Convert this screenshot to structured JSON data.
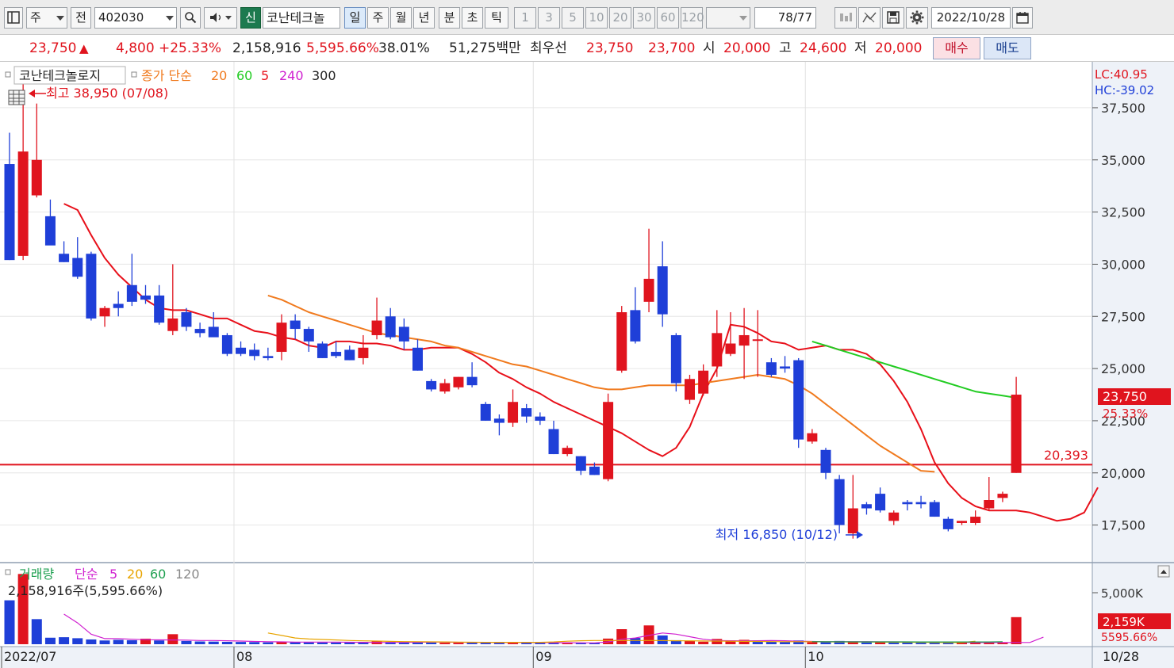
{
  "toolbar": {
    "type_select": "주",
    "prev_label": "전",
    "code_value": "402030",
    "new_badge": "신",
    "stock_name": "코난테크놀",
    "periods": [
      "일",
      "주",
      "월",
      "년",
      "분",
      "초",
      "틱"
    ],
    "selected_period": "일",
    "intervals": [
      "1",
      "3",
      "5",
      "10",
      "20",
      "30",
      "60",
      "120"
    ],
    "count": "78/77",
    "date": "2022/10/28"
  },
  "quote": {
    "price": "23,750",
    "change": "4,800",
    "change_pct": "+25.33%",
    "volume": "2,158,916",
    "volume_ratio": "5,595.66%",
    "turnover": "38.01%",
    "amount": "51,275백만",
    "best_bid_label": "최우선",
    "ask": "23,750",
    "bid": "23,700",
    "open_label": "시",
    "open": "20,000",
    "high_label": "고",
    "high": "24,600",
    "low_label": "저",
    "low": "20,000",
    "buy_label": "매수",
    "sell_label": "매도",
    "colors": {
      "up": "#e0141e",
      "down": "#1f3fd8"
    }
  },
  "price_panel": {
    "name_label": "코난테크놀로지",
    "ma_title": "종가 단순",
    "ma_periods": [
      {
        "label": "20",
        "color": "#f07a1e"
      },
      {
        "label": "60",
        "color": "#22cc22"
      },
      {
        "label": "5",
        "color": "#e8101a"
      },
      {
        "label": "240",
        "color": "#d020d0"
      },
      {
        "label": "300",
        "color": "#222222"
      }
    ],
    "high_annotation": "최고 38,950 (07/08)",
    "low_annotation": "최저 16,850 (10/12)",
    "lc_text": "LC:40.95",
    "hc_text": "HC:-39.02",
    "current_price_label": "23,750",
    "current_pct_label": "25.33%",
    "horizontal_line_label": "20,393"
  },
  "volume_panel": {
    "title": "거래량",
    "ma_title": "단순",
    "ma_periods": [
      {
        "label": "5",
        "color": "#d020d0"
      },
      {
        "label": "20",
        "color": "#e8a400"
      },
      {
        "label": "60",
        "color": "#1ea050"
      },
      {
        "label": "120",
        "color": "#888888"
      }
    ],
    "info": "2,158,916주(5,595.66%)",
    "axis_label": "5,000K",
    "current_label": "2,159K",
    "current_pct": "5595.66%"
  },
  "x_axis": {
    "labels": [
      "2022/07",
      "08",
      "09",
      "10"
    ],
    "right_label": "10/28"
  },
  "chart_data": {
    "type": "candlestick",
    "title": "코난테크놀로지",
    "y_ticks": [
      17500,
      20000,
      22500,
      25000,
      27500,
      30000,
      32500,
      35000,
      37500
    ],
    "ylim": [
      15700,
      39700
    ],
    "horizontal_line": 20393,
    "candles": [
      {
        "o": 34800,
        "h": 36300,
        "l": 30200,
        "c": 30200
      },
      {
        "o": 30400,
        "h": 38950,
        "l": 30200,
        "c": 35400
      },
      {
        "o": 33300,
        "h": 37700,
        "l": 33200,
        "c": 35000
      },
      {
        "o": 32300,
        "h": 33100,
        "l": 31000,
        "c": 30900
      },
      {
        "o": 30500,
        "h": 31100,
        "l": 30100,
        "c": 30100
      },
      {
        "o": 30300,
        "h": 31300,
        "l": 29300,
        "c": 29400
      },
      {
        "o": 30500,
        "h": 30600,
        "l": 27300,
        "c": 27400
      },
      {
        "o": 27500,
        "h": 28000,
        "l": 27000,
        "c": 27900
      },
      {
        "o": 28100,
        "h": 28700,
        "l": 27500,
        "c": 27900
      },
      {
        "o": 29000,
        "h": 30500,
        "l": 28000,
        "c": 28200
      },
      {
        "o": 28500,
        "h": 29000,
        "l": 28100,
        "c": 28300
      },
      {
        "o": 28500,
        "h": 29000,
        "l": 27100,
        "c": 27200
      },
      {
        "o": 26800,
        "h": 30000,
        "l": 26600,
        "c": 27400
      },
      {
        "o": 27700,
        "h": 27900,
        "l": 26800,
        "c": 27000
      },
      {
        "o": 26900,
        "h": 27200,
        "l": 26500,
        "c": 26700
      },
      {
        "o": 27000,
        "h": 27700,
        "l": 26600,
        "c": 26500
      },
      {
        "o": 26600,
        "h": 26700,
        "l": 25600,
        "c": 25700
      },
      {
        "o": 26000,
        "h": 26300,
        "l": 25600,
        "c": 25700
      },
      {
        "o": 25900,
        "h": 26200,
        "l": 25400,
        "c": 25600
      },
      {
        "o": 25600,
        "h": 26000,
        "l": 25400,
        "c": 25500
      },
      {
        "o": 25800,
        "h": 27600,
        "l": 25400,
        "c": 27200
      },
      {
        "o": 27300,
        "h": 27600,
        "l": 26400,
        "c": 26900
      },
      {
        "o": 26900,
        "h": 27000,
        "l": 25800,
        "c": 26300
      },
      {
        "o": 26200,
        "h": 26300,
        "l": 25500,
        "c": 25500
      },
      {
        "o": 25800,
        "h": 26300,
        "l": 25500,
        "c": 25600
      },
      {
        "o": 25900,
        "h": 26100,
        "l": 25400,
        "c": 25400
      },
      {
        "o": 25500,
        "h": 26600,
        "l": 25200,
        "c": 26000
      },
      {
        "o": 26600,
        "h": 28400,
        "l": 26400,
        "c": 27300
      },
      {
        "o": 27500,
        "h": 27900,
        "l": 26400,
        "c": 26500
      },
      {
        "o": 27000,
        "h": 27400,
        "l": 25900,
        "c": 26300
      },
      {
        "o": 26000,
        "h": 26400,
        "l": 24900,
        "c": 24900
      },
      {
        "o": 24400,
        "h": 24500,
        "l": 23900,
        "c": 24000
      },
      {
        "o": 23900,
        "h": 24500,
        "l": 23800,
        "c": 24300
      },
      {
        "o": 24100,
        "h": 24600,
        "l": 24000,
        "c": 24600
      },
      {
        "o": 24600,
        "h": 25300,
        "l": 24100,
        "c": 24200
      },
      {
        "o": 23300,
        "h": 23400,
        "l": 22500,
        "c": 22500
      },
      {
        "o": 22600,
        "h": 22800,
        "l": 21800,
        "c": 22400
      },
      {
        "o": 22400,
        "h": 24000,
        "l": 22200,
        "c": 23400
      },
      {
        "o": 23100,
        "h": 23300,
        "l": 22400,
        "c": 22700
      },
      {
        "o": 22700,
        "h": 22900,
        "l": 22300,
        "c": 22500
      },
      {
        "o": 22100,
        "h": 22500,
        "l": 20900,
        "c": 20900
      },
      {
        "o": 20900,
        "h": 21300,
        "l": 20800,
        "c": 21200
      },
      {
        "o": 20800,
        "h": 20800,
        "l": 19900,
        "c": 20100
      },
      {
        "o": 20300,
        "h": 20500,
        "l": 19900,
        "c": 19900
      },
      {
        "o": 19700,
        "h": 23800,
        "l": 19600,
        "c": 23400
      },
      {
        "o": 24900,
        "h": 28000,
        "l": 24800,
        "c": 27700
      },
      {
        "o": 27800,
        "h": 28900,
        "l": 26200,
        "c": 26300
      },
      {
        "o": 28200,
        "h": 31700,
        "l": 27700,
        "c": 29300
      },
      {
        "o": 29900,
        "h": 31100,
        "l": 27000,
        "c": 27600
      },
      {
        "o": 26600,
        "h": 26700,
        "l": 23900,
        "c": 24300
      },
      {
        "o": 23500,
        "h": 24700,
        "l": 23300,
        "c": 24500
      },
      {
        "o": 23800,
        "h": 25200,
        "l": 23700,
        "c": 24900
      },
      {
        "o": 25100,
        "h": 27800,
        "l": 24600,
        "c": 26700
      },
      {
        "o": 25700,
        "h": 27700,
        "l": 25600,
        "c": 26200
      },
      {
        "o": 26100,
        "h": 27900,
        "l": 24500,
        "c": 26600
      },
      {
        "o": 26400,
        "h": 27800,
        "l": 24600,
        "c": 26400
      },
      {
        "o": 25300,
        "h": 25500,
        "l": 24600,
        "c": 24700
      },
      {
        "o": 25100,
        "h": 25600,
        "l": 24800,
        "c": 25000
      },
      {
        "o": 25400,
        "h": 25500,
        "l": 21200,
        "c": 21600
      },
      {
        "o": 21500,
        "h": 22100,
        "l": 21400,
        "c": 21900
      },
      {
        "o": 21100,
        "h": 21200,
        "l": 19700,
        "c": 20000
      },
      {
        "o": 19700,
        "h": 19900,
        "l": 17100,
        "c": 17500
      },
      {
        "o": 17100,
        "h": 19900,
        "l": 16850,
        "c": 18300
      },
      {
        "o": 18500,
        "h": 18600,
        "l": 18000,
        "c": 18300
      },
      {
        "o": 19000,
        "h": 19300,
        "l": 18100,
        "c": 18200
      },
      {
        "o": 17700,
        "h": 18200,
        "l": 17500,
        "c": 18100
      },
      {
        "o": 18600,
        "h": 18700,
        "l": 18200,
        "c": 18500
      },
      {
        "o": 18600,
        "h": 18900,
        "l": 18300,
        "c": 18500
      },
      {
        "o": 18600,
        "h": 18700,
        "l": 17900,
        "c": 17900
      },
      {
        "o": 17800,
        "h": 17900,
        "l": 17200,
        "c": 17300
      },
      {
        "o": 17600,
        "h": 17700,
        "l": 17500,
        "c": 17700
      },
      {
        "o": 17600,
        "h": 18200,
        "l": 17500,
        "c": 17900
      },
      {
        "o": 18300,
        "h": 19800,
        "l": 18200,
        "c": 18700
      },
      {
        "o": 18800,
        "h": 19100,
        "l": 18600,
        "c": 19000
      },
      {
        "o": 20000,
        "h": 24600,
        "l": 20000,
        "c": 23750
      }
    ],
    "series": [
      {
        "name": "5",
        "start_index": 4,
        "values": [
          32900,
          32600,
          31400,
          30300,
          29500,
          28900,
          28300,
          27900,
          27800,
          27800,
          27600,
          27400,
          27400,
          27100,
          26800,
          26700,
          26500,
          26400,
          26100,
          26000,
          26300,
          26300,
          26200,
          26200,
          26100,
          25900,
          25900,
          26000,
          26000,
          26000,
          25700,
          25300,
          24800,
          24500,
          24100,
          23800,
          23400,
          23100,
          22800,
          22500,
          22200,
          21900,
          21500,
          21100,
          20800,
          21200,
          22200,
          23800,
          25000,
          27100,
          27000,
          26700,
          26300,
          26200,
          25900,
          26000,
          26100,
          25900,
          25900,
          25700,
          25200,
          24400,
          23400,
          22100,
          20500,
          19500,
          18800,
          18400,
          18200,
          18200,
          18200,
          18100,
          17900,
          17700,
          17800,
          18100,
          19300
        ]
      },
      {
        "name": "20",
        "start_index": 19,
        "values": [
          28500,
          28300,
          28000,
          27700,
          27500,
          27300,
          27100,
          26900,
          26700,
          26600,
          26500,
          26400,
          26300,
          26100,
          26000,
          25800,
          25600,
          25400,
          25200,
          25100,
          24900,
          24700,
          24500,
          24300,
          24100,
          24000,
          24000,
          24100,
          24200,
          24200,
          24200,
          24200,
          24300,
          24400,
          24500,
          24600,
          24700,
          24600,
          24500,
          24200,
          23800,
          23300,
          22800,
          22300,
          21800,
          21300,
          20900,
          20500,
          20100,
          20050
        ]
      },
      {
        "name": "60",
        "start_index": 59,
        "values": [
          26300,
          26100,
          25900,
          25700,
          25500,
          25300,
          25100,
          24900,
          24700,
          24500,
          24300,
          24100,
          23900,
          23800,
          23700,
          23600
        ]
      }
    ],
    "volume": [
      {
        "v": 3500,
        "up": false
      },
      {
        "v": 5600,
        "up": true
      },
      {
        "v": 2000,
        "up": false
      },
      {
        "v": 520,
        "up": false
      },
      {
        "v": 560,
        "up": false
      },
      {
        "v": 480,
        "up": false
      },
      {
        "v": 380,
        "up": false
      },
      {
        "v": 300,
        "up": false
      },
      {
        "v": 350,
        "up": false
      },
      {
        "v": 320,
        "up": false
      },
      {
        "v": 440,
        "up": true
      },
      {
        "v": 300,
        "up": false
      },
      {
        "v": 800,
        "up": true
      },
      {
        "v": 260,
        "up": false
      },
      {
        "v": 220,
        "up": false
      },
      {
        "v": 210,
        "up": false
      },
      {
        "v": 190,
        "up": false
      },
      {
        "v": 180,
        "up": false
      },
      {
        "v": 170,
        "up": false
      },
      {
        "v": 150,
        "up": false
      },
      {
        "v": 160,
        "up": true
      },
      {
        "v": 180,
        "up": false
      },
      {
        "v": 150,
        "up": false
      },
      {
        "v": 140,
        "up": false
      },
      {
        "v": 130,
        "up": false
      },
      {
        "v": 130,
        "up": false
      },
      {
        "v": 140,
        "up": false
      },
      {
        "v": 220,
        "up": true
      },
      {
        "v": 180,
        "up": false
      },
      {
        "v": 150,
        "up": false
      },
      {
        "v": 140,
        "up": false
      },
      {
        "v": 130,
        "up": false
      },
      {
        "v": 120,
        "up": true
      },
      {
        "v": 120,
        "up": true
      },
      {
        "v": 130,
        "up": false
      },
      {
        "v": 130,
        "up": false
      },
      {
        "v": 120,
        "up": false
      },
      {
        "v": 140,
        "up": true
      },
      {
        "v": 120,
        "up": false
      },
      {
        "v": 110,
        "up": false
      },
      {
        "v": 110,
        "up": false
      },
      {
        "v": 100,
        "up": true
      },
      {
        "v": 110,
        "up": false
      },
      {
        "v": 110,
        "up": false
      },
      {
        "v": 450,
        "up": true
      },
      {
        "v": 1200,
        "up": true
      },
      {
        "v": 500,
        "up": false
      },
      {
        "v": 1500,
        "up": true
      },
      {
        "v": 700,
        "up": false
      },
      {
        "v": 320,
        "up": false
      },
      {
        "v": 250,
        "up": true
      },
      {
        "v": 200,
        "up": true
      },
      {
        "v": 420,
        "up": true
      },
      {
        "v": 300,
        "up": true
      },
      {
        "v": 350,
        "up": true
      },
      {
        "v": 240,
        "up": false
      },
      {
        "v": 200,
        "up": false
      },
      {
        "v": 180,
        "up": false
      },
      {
        "v": 300,
        "up": false
      },
      {
        "v": 160,
        "up": true
      },
      {
        "v": 200,
        "up": false
      },
      {
        "v": 260,
        "up": false
      },
      {
        "v": 230,
        "up": true
      },
      {
        "v": 150,
        "up": false
      },
      {
        "v": 170,
        "up": true
      },
      {
        "v": 140,
        "up": false
      },
      {
        "v": 130,
        "up": false
      },
      {
        "v": 120,
        "up": false
      },
      {
        "v": 130,
        "up": false
      },
      {
        "v": 140,
        "up": false
      },
      {
        "v": 120,
        "up": true
      },
      {
        "v": 120,
        "up": true
      },
      {
        "v": 160,
        "up": true
      },
      {
        "v": 130,
        "up": true
      },
      {
        "v": 2159,
        "up": true
      }
    ],
    "volume_ma": [
      {
        "name": "5",
        "start_index": 4,
        "values": [
          2400,
          1700,
          800,
          450,
          440,
          400,
          360,
          350,
          340,
          330,
          300,
          300,
          280,
          250,
          220,
          200,
          190,
          170,
          170,
          170,
          170,
          160,
          150,
          140,
          140,
          150,
          160,
          170,
          170,
          150,
          150,
          140,
          130,
          130,
          130,
          130,
          120,
          120,
          115,
          110,
          180,
          400,
          500,
          700,
          900,
          800,
          600,
          400,
          300,
          280,
          270,
          280,
          300,
          280,
          240,
          220,
          200,
          210,
          200,
          210,
          190,
          190,
          180,
          170,
          160,
          150,
          140,
          130,
          130,
          130,
          140,
          140,
          560
        ]
      },
      {
        "name": "20",
        "start_index": 19,
        "values": [
          900,
          700,
          500,
          420,
          380,
          340,
          300,
          270,
          250,
          230,
          210,
          200,
          190,
          180,
          170,
          160,
          150,
          150,
          150,
          150,
          150,
          180,
          240,
          280,
          300,
          300,
          300,
          300,
          300,
          290,
          280,
          270,
          260,
          250,
          240,
          230,
          220,
          210,
          200,
          200,
          200,
          190,
          180,
          180,
          180,
          170,
          160,
          155,
          150,
          140,
          130,
          130,
          240
        ]
      },
      {
        "name": "60",
        "start_index": 59,
        "values": [
          200,
          200,
          200,
          190,
          190,
          190,
          190,
          190,
          180,
          180,
          180,
          180,
          180,
          180,
          200
        ]
      }
    ],
    "volume_ylim": [
      0,
      6000
    ],
    "volume_unit": "K",
    "x_month_labels": [
      {
        "label": "2022/07",
        "index": 0
      },
      {
        "label": "08",
        "index": 17
      },
      {
        "label": "09",
        "index": 39
      },
      {
        "label": "10",
        "index": 59
      }
    ]
  }
}
